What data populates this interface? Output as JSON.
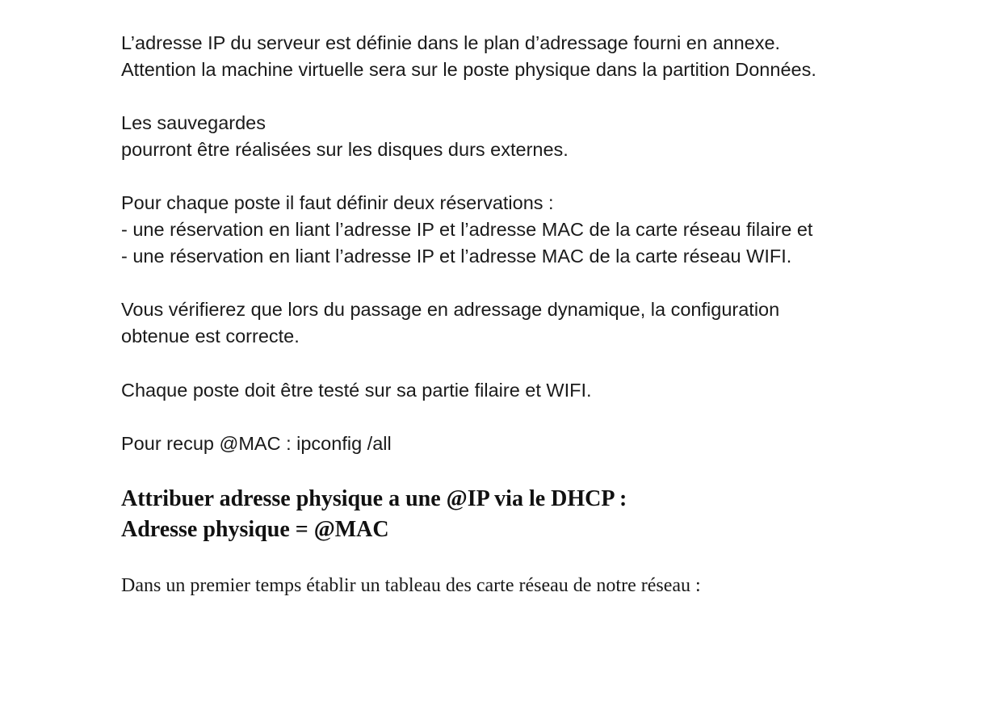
{
  "paragraphs": {
    "serveur": {
      "line1": "L’adresse IP du serveur est définie dans le plan d’adressage fourni en annexe.",
      "line2": "Attention la machine virtuelle sera sur le poste physique dans la partition Données."
    },
    "sauvegardes": {
      "line1": "Les sauvegardes",
      "line2": "pourront être réalisées sur les disques durs externes."
    },
    "reservations": {
      "line1": "Pour chaque poste il faut définir deux réservations :",
      "item1": "- une réservation en liant l’adresse IP et l’adresse MAC de la carte réseau filaire et",
      "item2": "- une réservation en liant l’adresse IP et l’adresse MAC de la carte réseau WIFI."
    },
    "verification": {
      "line1": "Vous vérifierez que lors du passage en adressage dynamique, la configuration",
      "line2": "obtenue est correcte."
    },
    "test": {
      "line1": "Chaque poste doit être testé sur sa partie filaire et WIFI."
    },
    "recup_mac": {
      "line1": "Pour recup @MAC : ipconfig /all"
    }
  },
  "heading": {
    "line1": "Attribuer adresse physique a une @IP via le DHCP :",
    "line2": "Adresse physique = @MAC"
  },
  "intro": {
    "line1": "Dans un premier temps établir un tableau des carte réseau de notre réseau :"
  }
}
